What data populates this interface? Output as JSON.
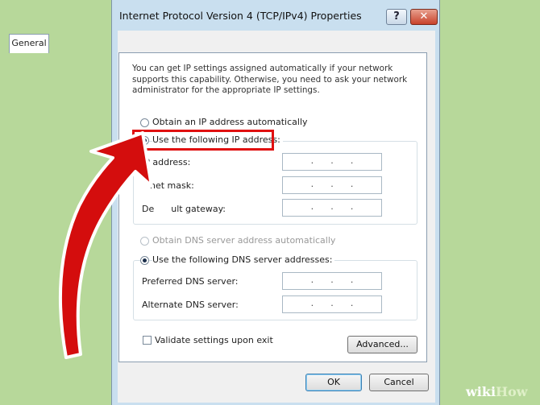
{
  "window": {
    "title": "Internet Protocol Version 4 (TCP/IPv4) Properties",
    "help_label": "?",
    "close_label": "✕"
  },
  "tabs": [
    {
      "label": "General"
    }
  ],
  "description": "You can get IP settings assigned automatically if your network supports this capability. Otherwise, you need to ask your network administrator for the appropriate IP settings.",
  "ip_section": {
    "auto_label": "Obtain an IP address automatically",
    "manual_label": "Use the following IP address:",
    "selected": "manual",
    "fields": [
      {
        "label": "IP address:",
        "value": ". . ."
      },
      {
        "label": "net mask:",
        "value": ". . ."
      },
      {
        "label": "De      ult gateway:",
        "value": ". . ."
      }
    ]
  },
  "dns_section": {
    "auto_label": "Obtain DNS server address automatically",
    "manual_label": "Use the following DNS server addresses:",
    "selected": "manual",
    "fields": [
      {
        "label": "Preferred DNS server:",
        "value": ". . ."
      },
      {
        "label": "Alternate DNS server:",
        "value": ". . ."
      }
    ]
  },
  "validate_label": "Validate settings upon exit",
  "validate_checked": false,
  "buttons": {
    "advanced": "Advanced...",
    "ok": "OK",
    "cancel": "Cancel"
  },
  "annotation": {
    "highlight_color": "#e01010",
    "arrow_color": "#e01010"
  },
  "watermark": {
    "wiki": "wiki",
    "how": "How"
  }
}
